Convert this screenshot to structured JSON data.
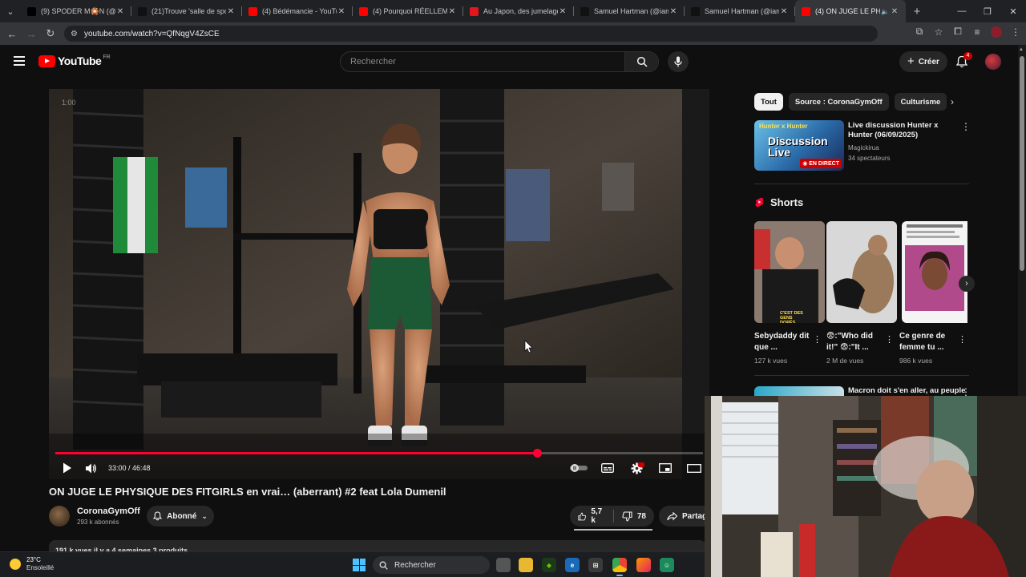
{
  "browser": {
    "tabs": [
      {
        "title": "(9) SPODER M🎇N (@Sp",
        "favicon": "x-icon",
        "color": "#000000",
        "active": false
      },
      {
        "title": "(21)Trouve 'salle de sport",
        "favicon": "tiktok-icon",
        "color": "#111111",
        "active": false
      },
      {
        "title": "(4) Bédémancie - YouTub",
        "favicon": "youtube-icon",
        "color": "#ff0000",
        "active": false
      },
      {
        "title": "(4) Pourquoi RÉELLEMENT",
        "favicon": "youtube-icon",
        "color": "#ff0000",
        "active": false
      },
      {
        "title": "Au Japon, des jumelages",
        "favicon": "news-icon",
        "color": "#e2161d",
        "active": false
      },
      {
        "title": "Samuel Hartman (@iam.s",
        "favicon": "tiktok-icon",
        "color": "#111111",
        "active": false
      },
      {
        "title": "Samuel Hartman (@iam.s",
        "favicon": "tiktok-icon",
        "color": "#111111",
        "active": false
      },
      {
        "title": "(4) ON JUGE LE PHYSI",
        "favicon": "youtube-icon",
        "color": "#ff0000",
        "active": true
      }
    ],
    "url": "youtube.com/watch?v=QfNqgV4ZsCE"
  },
  "header": {
    "logo_text": "YouTube",
    "country": "FR",
    "search_placeholder": "Rechercher",
    "create_label": "Créer",
    "notifications_count": "4"
  },
  "player": {
    "time_current": "33:00",
    "time_total": "46:48",
    "time_display": "33:00 / 46:48",
    "progress": 0.744,
    "watermark": "1:00"
  },
  "video": {
    "title": "ON JUGE LE PHYSIQUE DES FITGIRLS en vrai… (aberrant) #2 feat Lola Dumenil",
    "channel": "CoronaGymOff",
    "subscribers": "293 k abonnés",
    "subscribe_label": "Abonné",
    "likes": "5,7 k",
    "dislikes": "78",
    "share_label": "Partager",
    "description_peek": "191 k vues  il y a 4 semaines  3 produits"
  },
  "sidebar": {
    "chips": [
      "Tout",
      "Source : CoronaGymOff",
      "Culturisme"
    ],
    "rec1": {
      "thumb_line1": "Hunter x Hunter",
      "thumb_line2": "Discussion Live",
      "live_badge": "EN DIRECT",
      "title": "Live discussion Hunter x Hunter (06/09/2025)",
      "channel": "Magickirua",
      "meta": "34 spectateurs"
    },
    "shorts_heading": "Shorts",
    "shorts": [
      {
        "title": "Sebydaddy dit que ...",
        "views": "127 k vues",
        "thumb_caption": "C'EST DES GENS DOPÉS"
      },
      {
        "title": "😨:\"Who did it!\" 😨:\"It ...",
        "views": "2 M de vues",
        "thumb_caption": ""
      },
      {
        "title": "Ce genre de femme tu ...",
        "views": "986 k vues",
        "thumb_caption": ""
      }
    ],
    "rec2": {
      "title": "Macron doit s'en aller, au peuple"
    }
  },
  "taskbar": {
    "temperature": "23°C",
    "condition": "Ensoleillé",
    "search_label": "Rechercher"
  },
  "colors": {
    "accent": "#ff0033",
    "youtube_red": "#ff0000",
    "live": "#cc0000"
  }
}
